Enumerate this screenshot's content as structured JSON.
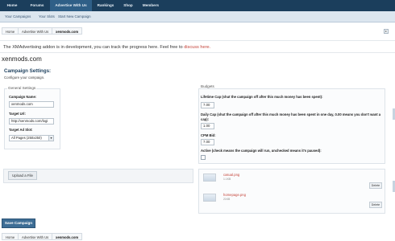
{
  "topnav": {
    "items": [
      {
        "label": "Home"
      },
      {
        "label": "Forums"
      },
      {
        "label": "Advertise With Us"
      },
      {
        "label": "Rankings"
      },
      {
        "label": "Shop"
      },
      {
        "label": "Members"
      }
    ]
  },
  "subnav": {
    "items": [
      {
        "label": "Your Campaigns"
      },
      {
        "label": "Your Slots"
      },
      {
        "label": "Start New Campaign"
      }
    ]
  },
  "breadcrumb": {
    "items": [
      "Home",
      "Advertise With Us",
      "xenmods.com"
    ]
  },
  "notice": {
    "text": "The XMAdvertising addon is in development, you can track the progress here. Feel free to ",
    "link": "discuss here."
  },
  "page": {
    "site_title": "xenmods.com",
    "panel_title": "Campaign Settings:",
    "panel_subtitle": "Configure your campaign."
  },
  "general": {
    "legend": "General Settings",
    "campaign_name_label": "Campaign Name:",
    "campaign_name_value": "xenmods.com",
    "target_url_label": "Target Url:",
    "target_url_value": "http://xenmods.com/logi",
    "target_ad_slot_label": "Target Ad Slot:",
    "target_ad_slot_value": "All Pages (250x250)"
  },
  "budgets": {
    "legend": "Budgets",
    "lifetime_cap_label": "Lifetime Cap (shut the campaign off after this much money has been spent):",
    "lifetime_cap_value": "7.00",
    "daily_cap_label": "Daily Cap (shut the campaign off after this much money has been spent in one day, 0.00 means you don't want a cap):",
    "daily_cap_value": "1.00",
    "cpm_bid_label": "CPM Bid:",
    "cpm_bid_value": "7.00",
    "active_label": "Active (check means the campaign will run, unchecked means it's paused):"
  },
  "upload": {
    "button_label": "Upload a File"
  },
  "files": [
    {
      "name": "casual.png",
      "size": "1.1KB",
      "delete_label": "Delete"
    },
    {
      "name": "homepage.png",
      "size": "21KB",
      "delete_label": "Delete"
    }
  ],
  "actions": {
    "save_label": "Save Campaign"
  },
  "icons": {
    "collapse": "collapse-icon",
    "dropdown": "chevron-down-icon"
  },
  "colors": {
    "topnav_bg": "#1b3e5c",
    "subnav_bg": "#dce6ef",
    "link_red": "#c4443a",
    "save_button": "#3d6d95"
  }
}
